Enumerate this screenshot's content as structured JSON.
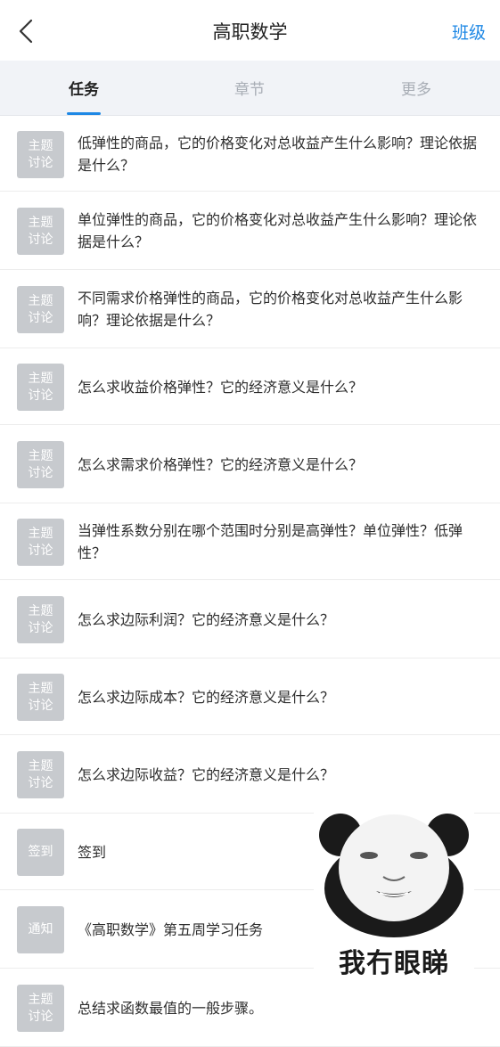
{
  "header": {
    "title": "高职数学",
    "right_link": "班级"
  },
  "tabs": [
    {
      "label": "任务"
    },
    {
      "label": "章节"
    },
    {
      "label": "更多"
    }
  ],
  "items": [
    {
      "badge": [
        "主题",
        "讨论"
      ],
      "text": "低弹性的商品，它的价格变化对总收益产生什么影响？理论依据是什么？"
    },
    {
      "badge": [
        "主题",
        "讨论"
      ],
      "text": "单位弹性的商品，它的价格变化对总收益产生什么影响？理论依据是什么？"
    },
    {
      "badge": [
        "主题",
        "讨论"
      ],
      "text": "不同需求价格弹性的商品，它的价格变化对总收益产生什么影响？理论依据是什么？"
    },
    {
      "badge": [
        "主题",
        "讨论"
      ],
      "text": "怎么求收益价格弹性？它的经济意义是什么？"
    },
    {
      "badge": [
        "主题",
        "讨论"
      ],
      "text": "怎么求需求价格弹性？它的经济意义是什么？"
    },
    {
      "badge": [
        "主题",
        "讨论"
      ],
      "text": "当弹性系数分别在哪个范围时分别是高弹性？单位弹性？低弹性？"
    },
    {
      "badge": [
        "主题",
        "讨论"
      ],
      "text": "怎么求边际利润？它的经济意义是什么？"
    },
    {
      "badge": [
        "主题",
        "讨论"
      ],
      "text": "怎么求边际成本？它的经济意义是什么？"
    },
    {
      "badge": [
        "主题",
        "讨论"
      ],
      "text": "怎么求边际收益？它的经济意义是什么？"
    },
    {
      "badge": [
        "签到"
      ],
      "text": "签到"
    },
    {
      "badge": [
        "通知"
      ],
      "text": "《高职数学》第五周学习任务"
    },
    {
      "badge": [
        "主题",
        "讨论"
      ],
      "text": "总结求函数最值的一般步骤。"
    }
  ],
  "sticker": {
    "caption": "我冇眼睇"
  }
}
